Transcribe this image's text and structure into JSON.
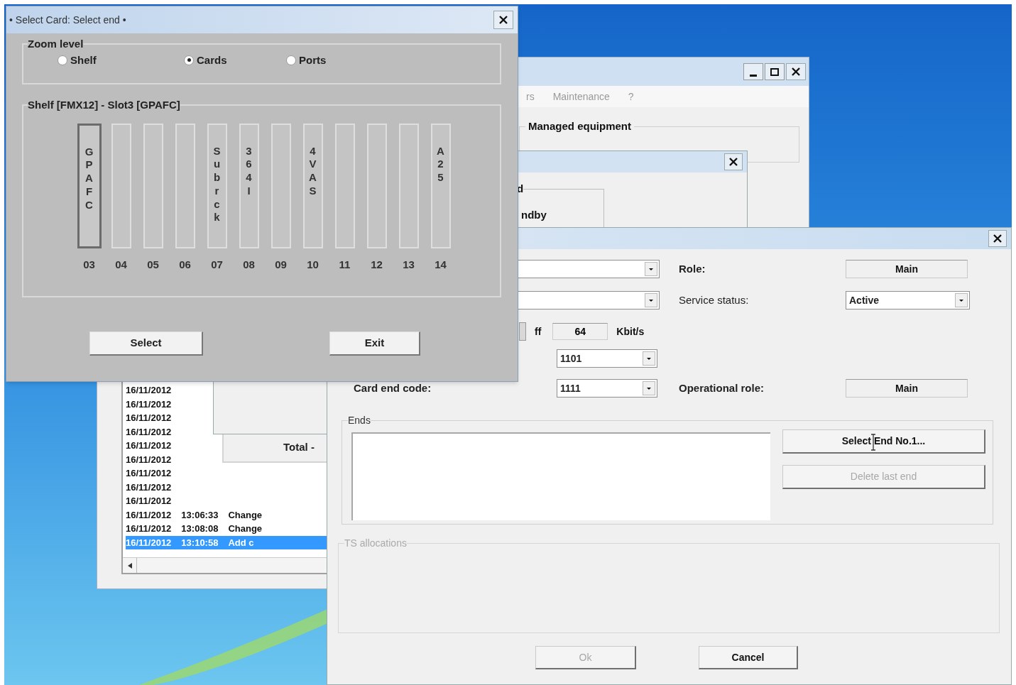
{
  "main_window": {
    "menu": [
      "rs",
      "Maintenance",
      "?"
    ],
    "equipment_group": "Managed equipment",
    "log_rows": [
      {
        "date": "16/11/2012",
        "selected": false
      },
      {
        "date": "16/11/2012",
        "selected": false
      },
      {
        "date": "16/11/2012",
        "selected": false
      },
      {
        "date": "16/11/2012",
        "selected": false
      },
      {
        "date": "16/11/2012",
        "selected": false
      },
      {
        "date": "16/11/2012",
        "selected": false
      },
      {
        "date": "16/11/2012",
        "selected": false
      },
      {
        "date": "16/11/2012",
        "selected": false
      },
      {
        "date": "16/11/2012",
        "selected": false
      },
      {
        "date": "16/11/2012",
        "time": "13:06:33",
        "action": "Change",
        "selected": false
      },
      {
        "date": "16/11/2012",
        "time": "13:08:08",
        "action": "Change",
        "selected": false
      },
      {
        "date": "16/11/2012",
        "time": "13:10:58",
        "action": "Add c",
        "selected": true
      }
    ],
    "total_label": "Total -"
  },
  "middle_window": {
    "group_title": "d",
    "field_label": "ndby"
  },
  "end_dialog": {
    "role_label": "Role:",
    "role": "Main",
    "service_status_label": "Service status:",
    "service_status": "Active",
    "rate_label": "ff",
    "rate": "64",
    "rate_unit": "Kbit/s",
    "code_1": "1101",
    "card_end_code_label": "Card end code:",
    "card_end_code": "1111",
    "operational_role_label": "Operational role:",
    "operational_role": "Main",
    "ends_group": "Ends",
    "select_end_button": {
      "label": "Select End No.1...",
      "disabled": false
    },
    "delete_end_button": {
      "label": "Delete last end",
      "disabled": true
    },
    "ts_group": {
      "title": "TS allocations",
      "disabled": true
    },
    "ok_button": {
      "label": "Ok",
      "disabled": true
    },
    "cancel_button": {
      "label": "Cancel",
      "disabled": false
    }
  },
  "select_card_dialog": {
    "title": "• Select Card: Select end •",
    "zoom_group": "Zoom level",
    "zoom_options": [
      {
        "label": "Shelf",
        "selected": false
      },
      {
        "label": "Cards",
        "selected": true
      },
      {
        "label": "Ports",
        "selected": false
      }
    ],
    "shelf_group": "Shelf [FMX12] - Slot3 [GPAFC]",
    "slots": [
      {
        "number": "03",
        "label": "GPAFC",
        "selected": true
      },
      {
        "number": "04",
        "selected": false
      },
      {
        "number": "05",
        "selected": false
      },
      {
        "number": "06",
        "selected": false
      },
      {
        "number": "07",
        "label": "Subrck",
        "selected": false
      },
      {
        "number": "08",
        "label": "3 64 I",
        "selected": false
      },
      {
        "number": "09",
        "selected": false
      },
      {
        "number": "10",
        "label": "4VAS",
        "selected": false
      },
      {
        "number": "11",
        "selected": false
      },
      {
        "number": "12",
        "selected": false
      },
      {
        "number": "13",
        "selected": false
      },
      {
        "number": "14",
        "label": "A25",
        "selected": false
      }
    ],
    "buttons": [
      "Select",
      "Exit"
    ]
  }
}
